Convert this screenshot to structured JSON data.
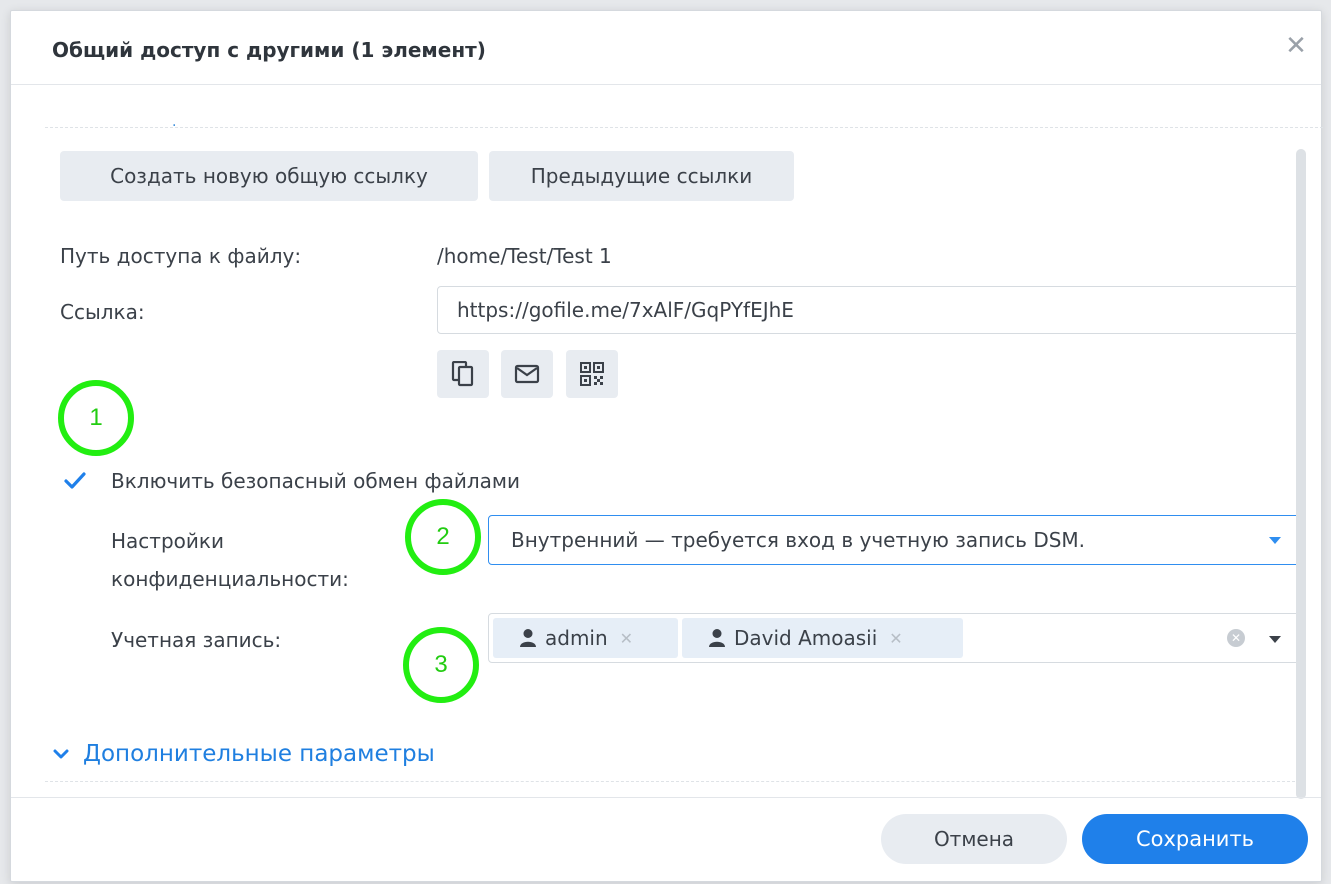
{
  "dialog": {
    "title": "Общий доступ с другими (1 элемент)",
    "close_icon": "close-icon"
  },
  "tabs": [
    {
      "label": "Создать новую общую ссылку"
    },
    {
      "label": "Предыдущие ссылки"
    }
  ],
  "file_path": {
    "label": "Путь доступа к файлу:",
    "value": "/home/Test/Test 1"
  },
  "link": {
    "label": "Ссылка:",
    "value": "https://gofile.me/7xAlF/GqPYfEJhE"
  },
  "link_actions": [
    {
      "icon": "copy-icon"
    },
    {
      "icon": "email-icon"
    },
    {
      "icon": "qr-code-icon"
    }
  ],
  "annotations": [
    "1",
    "2",
    "3"
  ],
  "secure_sharing": {
    "label": "Включить безопасный обмен файлами",
    "checked": true
  },
  "privacy": {
    "label_line1": "Настройки",
    "label_line2": "конфиденциальности:",
    "selected": "Внутренний — требуется вход в учетную запись DSM."
  },
  "account": {
    "label": "Учетная запись:",
    "tags": [
      {
        "name": "admin",
        "icon": "user-icon"
      },
      {
        "name": "David Amoasii",
        "icon": "user-icon"
      }
    ]
  },
  "advanced": {
    "label": "Дополнительные параметры",
    "icon": "chevron-down-icon"
  },
  "footer": {
    "cancel": "Отмена",
    "save": "Сохранить"
  },
  "colors": {
    "accent": "#1f80ea",
    "annotation": "#22ee11"
  }
}
